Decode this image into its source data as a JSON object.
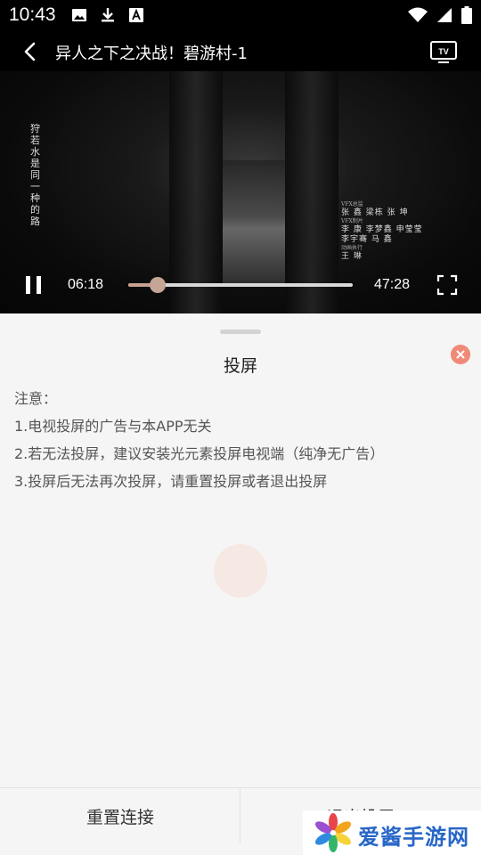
{
  "status_bar": {
    "time": "10:43",
    "left_icons": [
      "image-icon",
      "download-icon",
      "font-icon"
    ],
    "right_icons": [
      "wifi-icon",
      "signal-icon",
      "battery-icon"
    ]
  },
  "header": {
    "title": "异人之下之决战！碧游村-1"
  },
  "video": {
    "overlay_vertical_text": "狩若水是同一种的路",
    "credits": [
      {
        "role": "VFX总监",
        "names": "张 鑫  梁栋  张 坤"
      },
      {
        "role": "VFX制片",
        "names": "李 康  李梦鑫  申莹莹"
      },
      {
        "role": "",
        "names": "李宇骞  马 鑫"
      },
      {
        "role": "动画执行",
        "names": "王 琳"
      }
    ],
    "current_time": "06:18",
    "total_time": "47:28",
    "progress": 0.13
  },
  "sheet": {
    "title": "投屏",
    "notes": [
      "注意：",
      "1.电视投屏的广告与本APP无关",
      "2.若无法投屏，建议安装光元素投屏电视端（纯净无广告）",
      "3.投屏后无法再次投屏，请重置投屏或者退出投屏"
    ],
    "buttons": {
      "reset": "重置连接",
      "exit": "退出投屏"
    }
  },
  "watermark": {
    "text": "爱酱手游网"
  },
  "colors": {
    "accent": "#c4a596",
    "close": "#f08a78",
    "watermark_blue": "#2766c7"
  }
}
